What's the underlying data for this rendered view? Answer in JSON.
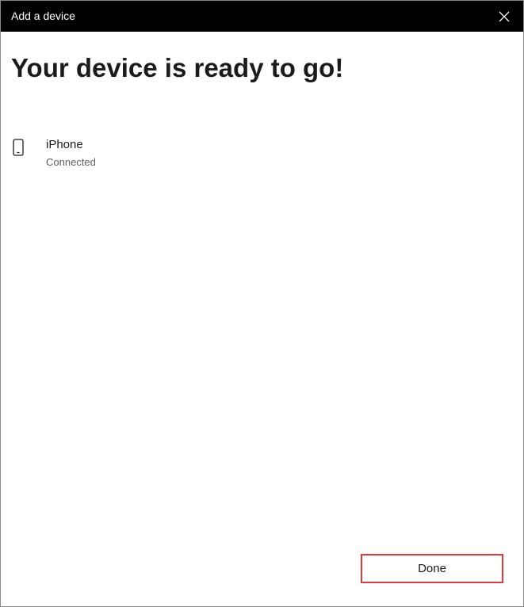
{
  "window": {
    "title": "Add a device",
    "close_icon": "close-icon"
  },
  "main": {
    "heading": "Your device is ready to go!",
    "device": {
      "icon": "phone-icon",
      "name": "iPhone",
      "status": "Connected"
    }
  },
  "footer": {
    "done_label": "Done"
  },
  "colors": {
    "titlebar_bg": "#000000",
    "highlight_border": "#e0393a"
  }
}
